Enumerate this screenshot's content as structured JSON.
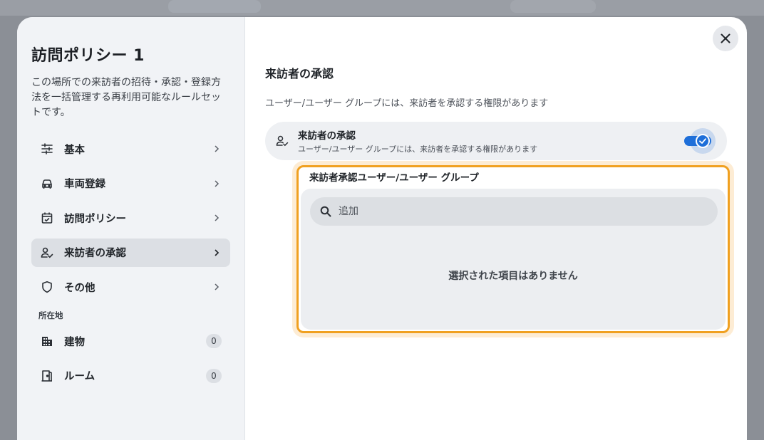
{
  "sidebar": {
    "title": "訪問ポリシー 1",
    "description": "この場所での来訪者の招待・承認・登録方法を一括管理する再利用可能なルールセットです。",
    "items": [
      {
        "label": "基本",
        "icon": "sliders-icon"
      },
      {
        "label": "車両登録",
        "icon": "car-icon"
      },
      {
        "label": "訪問ポリシー",
        "icon": "calendar-check-icon"
      },
      {
        "label": "来訪者の承認",
        "icon": "user-check-icon",
        "active": true
      },
      {
        "label": "その他",
        "icon": "shield-icon"
      }
    ],
    "location_section_label": "所在地",
    "location_items": [
      {
        "label": "建物",
        "count": "0",
        "icon": "building-icon"
      },
      {
        "label": "ルーム",
        "count": "0",
        "icon": "door-icon"
      }
    ]
  },
  "main": {
    "title": "来訪者の承認",
    "description": "ユーザー/ユーザー グループには、来訪者を承認する権限があります",
    "toggle_card": {
      "title": "来訪者の承認",
      "subtitle": "ユーザー/ユーザー グループには、来訪者を承認する権限があります",
      "enabled": true
    },
    "approvers": {
      "title": "来訪者承認ユーザー/ユーザー グループ",
      "search_placeholder": "追加",
      "empty_text": "選択された項目はありません"
    }
  },
  "colors": {
    "accent": "#1e6fd9",
    "highlight": "#f0a020"
  }
}
